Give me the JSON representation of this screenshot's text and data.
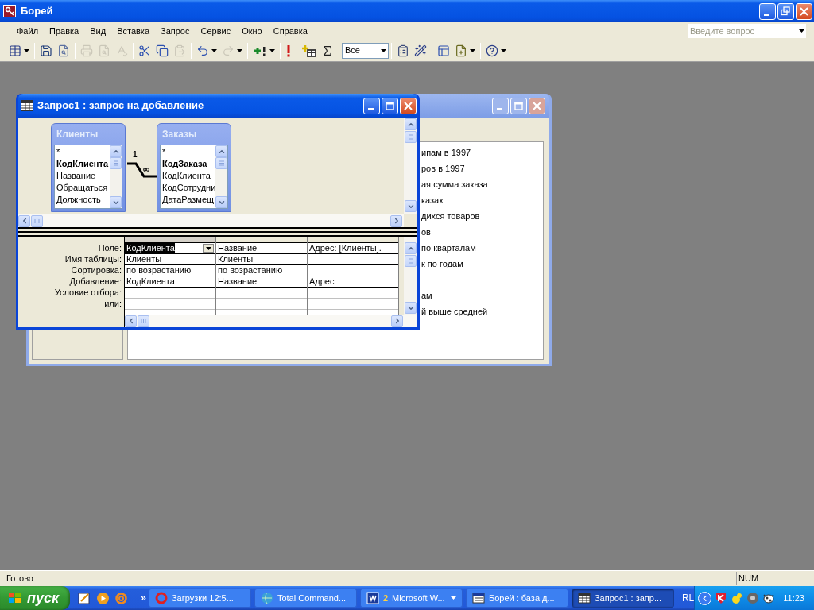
{
  "app_window": {
    "title": "Борей"
  },
  "menu": [
    {
      "label": "Файл"
    },
    {
      "label": "Правка"
    },
    {
      "label": "Вид"
    },
    {
      "label": "Вставка"
    },
    {
      "label": "Запрос"
    },
    {
      "label": "Сервис"
    },
    {
      "label": "Окно"
    },
    {
      "label": "Справка"
    }
  ],
  "help_box": {
    "placeholder": "Введите вопрос"
  },
  "toolbar": {
    "buttons": [
      {
        "disabled": false,
        "menu_arrow": true
      },
      {
        "disabled": false,
        "menu_arrow": false
      },
      {
        "disabled": false,
        "menu_arrow": false
      },
      {
        "disabled": true,
        "menu_arrow": false
      },
      {
        "disabled": true,
        "menu_arrow": false
      },
      {
        "disabled": true,
        "menu_arrow": false
      },
      {
        "disabled": false,
        "menu_arrow": false
      },
      {
        "disabled": false,
        "menu_arrow": false
      },
      {
        "disabled": true,
        "menu_arrow": false
      },
      {
        "disabled": false,
        "menu_arrow": true
      },
      {
        "disabled": true,
        "menu_arrow": true
      },
      {
        "disabled": false,
        "menu_arrow": true
      },
      {
        "disabled": false,
        "menu_arrow": false
      },
      {
        "disabled": false,
        "menu_arrow": false
      },
      {
        "disabled": false,
        "menu_arrow": false
      },
      {
        "disabled": false,
        "menu_arrow": false
      },
      {
        "disabled": false,
        "menu_arrow": false
      },
      {
        "disabled": false,
        "menu_arrow": false
      },
      {
        "disabled": false,
        "menu_arrow": true
      },
      {
        "disabled": false,
        "menu_arrow": true
      }
    ],
    "top_values": "Все"
  },
  "db_window": {
    "items": [
      "ипам в 1997",
      "ров в 1997",
      "ая сумма заказа",
      "казах",
      "дихся товаров",
      "ов",
      "по кварталам",
      "к по годам",
      "ам",
      "й выше средней"
    ]
  },
  "query_window": {
    "title": "Запрос1 : запрос на добавление",
    "tables": [
      {
        "name": "Клиенты",
        "fields": [
          {
            "name": "*",
            "key": false
          },
          {
            "name": "КодКлиента",
            "key": true
          },
          {
            "name": "Название",
            "key": false
          },
          {
            "name": "Обращаться",
            "key": false
          },
          {
            "name": "Должность",
            "key": false
          }
        ]
      },
      {
        "name": "Заказы",
        "fields": [
          {
            "name": "*",
            "key": false
          },
          {
            "name": "КодЗаказа",
            "key": true
          },
          {
            "name": "КодКлиента",
            "key": false
          },
          {
            "name": "КодСотрудни",
            "key": false
          },
          {
            "name": "ДатаРазмещ",
            "key": false
          }
        ]
      }
    ],
    "relationship": {
      "one_label": "1",
      "many_label": "∞"
    },
    "grid": {
      "row_labels": [
        "Поле:",
        "Имя таблицы:",
        "Сортировка:",
        "Добавление:",
        "Условие отбора:",
        "или:"
      ],
      "columns": [
        {
          "selected": true,
          "field": "КодКлиента",
          "table": "Клиенты",
          "sort": "по возрастанию",
          "append": "КодКлиента"
        },
        {
          "selected": false,
          "field": "Название",
          "table": "Клиенты",
          "sort": "по возрастанию",
          "append": "Название"
        },
        {
          "selected": false,
          "field": "Адрес: [Клиенты].",
          "append": "Адрес"
        }
      ]
    }
  },
  "status_bar": {
    "message": "Готово",
    "indicator": "NUM"
  },
  "taskbar": {
    "start": "пуск",
    "more": "»",
    "tasks": [
      {
        "label": "Загрузки 12:5...",
        "selected": false
      },
      {
        "label": "Total Command...",
        "selected": false
      },
      {
        "count": "2",
        "label": "Microsoft W...",
        "selected": false
      },
      {
        "label": "Борей : база д...",
        "selected": false
      },
      {
        "label": "Запрос1 : запр...",
        "selected": true
      }
    ],
    "language": "RL",
    "clock": "11:23"
  }
}
